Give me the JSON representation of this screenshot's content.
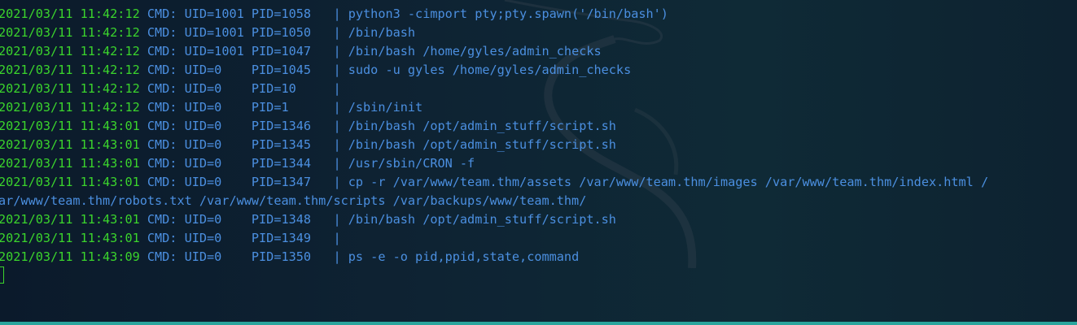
{
  "terminal": {
    "rows": [
      {
        "ts": "2021/03/11 11:42:12",
        "cmd": " CMD: UID=1001 PID=1058   | python3 -cimport pty;pty.spawn('/bin/bash')"
      },
      {
        "ts": "2021/03/11 11:42:12",
        "cmd": " CMD: UID=1001 PID=1050   | /bin/bash"
      },
      {
        "ts": "2021/03/11 11:42:12",
        "cmd": " CMD: UID=1001 PID=1047   | /bin/bash /home/gyles/admin_checks"
      },
      {
        "ts": "2021/03/11 11:42:12",
        "cmd": " CMD: UID=0    PID=1045   | sudo -u gyles /home/gyles/admin_checks"
      },
      {
        "ts": "2021/03/11 11:42:12",
        "cmd": " CMD: UID=0    PID=10     |"
      },
      {
        "ts": "2021/03/11 11:42:12",
        "cmd": " CMD: UID=0    PID=1      | /sbin/init"
      },
      {
        "ts": "2021/03/11 11:43:01",
        "cmd": " CMD: UID=0    PID=1346   | /bin/bash /opt/admin_stuff/script.sh"
      },
      {
        "ts": "2021/03/11 11:43:01",
        "cmd": " CMD: UID=0    PID=1345   | /bin/bash /opt/admin_stuff/script.sh"
      },
      {
        "ts": "2021/03/11 11:43:01",
        "cmd": " CMD: UID=0    PID=1344   | /usr/sbin/CRON -f"
      },
      {
        "ts": "2021/03/11 11:43:01",
        "cmd": " CMD: UID=0    PID=1347   | cp -r /var/www/team.thm/assets /var/www/team.thm/images /var/www/team.thm/index.html /"
      },
      {
        "wrap": "ar/www/team.thm/robots.txt /var/www/team.thm/scripts /var/backups/www/team.thm/"
      },
      {
        "ts": "2021/03/11 11:43:01",
        "cmd": " CMD: UID=0    PID=1348   | /bin/bash /opt/admin_stuff/script.sh"
      },
      {
        "ts": "2021/03/11 11:43:01",
        "cmd": " CMD: UID=0    PID=1349   |"
      },
      {
        "ts": "2021/03/11 11:43:09",
        "cmd": " CMD: UID=0    PID=1350   | ps -e -o pid,ppid,state,command"
      }
    ]
  },
  "colors": {
    "timestamp": "#3bd42c",
    "command": "#4b8fe0",
    "background": "#0e2333",
    "bottom_bar": "#2aa59d"
  }
}
